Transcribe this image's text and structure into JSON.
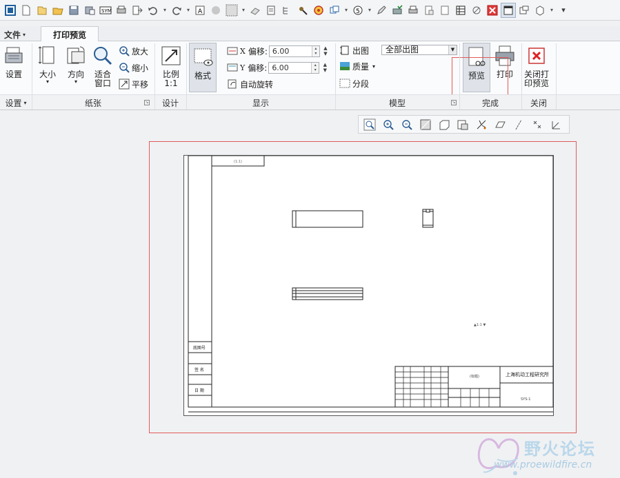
{
  "quick_access": {
    "icons": [
      "app-window-icon",
      "new-file-icon",
      "open-folder-icon",
      "open-icon",
      "save-icon",
      "save-as-icon",
      "regenerate-icon",
      "print-icon",
      "export-icon",
      "undo-icon",
      "redo-icon",
      "annotation-icon",
      "sphere-icon",
      "box-select-icon",
      "eraser-icon",
      "relations-icon",
      "tree-icon",
      "tools-icon",
      "target-icon",
      "windows-icon",
      "step-icon",
      "pencil-icon",
      "check-icon",
      "print-icon",
      "doc-icon",
      "doc2-icon",
      "table-icon",
      "no-icon",
      "close-icon",
      "active-window-icon",
      "view-icon",
      "3d-icon",
      "more-icon"
    ]
  },
  "tabs": {
    "file_label": "文件",
    "active_label": "打印预览"
  },
  "ribbon": {
    "settings": {
      "label": "设置"
    },
    "size": {
      "label": "大小"
    },
    "orientation": {
      "label": "方向"
    },
    "fit_window": {
      "label": "适合\n窗口"
    },
    "zoom_in": {
      "label": "放大"
    },
    "zoom_out": {
      "label": "缩小"
    },
    "pan": {
      "label": "平移"
    },
    "scale": {
      "label": "比例",
      "value": "1:1"
    },
    "format": {
      "label": "格式"
    },
    "x_offset": {
      "axis": "X",
      "label": "偏移:",
      "value": "6.00"
    },
    "y_offset": {
      "axis": "Y",
      "label": "偏移:",
      "value": "6.00"
    },
    "auto_rotate": {
      "label": "自动旋转"
    },
    "output": {
      "label": "出图",
      "selected": "全部出图"
    },
    "quality": {
      "label": "质量"
    },
    "segment": {
      "label": "分段"
    },
    "preview": {
      "label": "预览"
    },
    "print": {
      "label": "打印"
    },
    "close_preview": {
      "label": "关闭打\n印预览"
    }
  },
  "groups": {
    "settings": "设置",
    "paper": "纸张",
    "design": "设计",
    "display": "显示",
    "model": "模型",
    "finish": "完成",
    "close": "关闭"
  },
  "drawing": {
    "title_company": "上海机动工程研究所",
    "drawing_no": "SYS-1",
    "scale_note": "1:1"
  },
  "watermark": {
    "text": "野火论坛",
    "url": "www.proewildfire.cn"
  }
}
